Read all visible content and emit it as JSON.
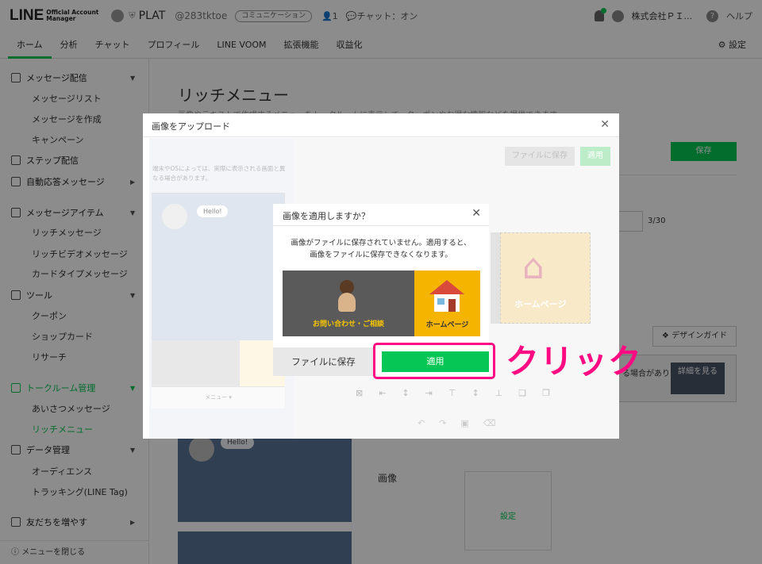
{
  "header": {
    "logo_line": "LINE",
    "logo_sub_1": "Official Account",
    "logo_sub_2": "Manager",
    "account_name": "PLAT",
    "account_id": "@283tktoe",
    "account_tag": "コミュニケーション",
    "friends_count": "1",
    "chat_status": "チャット：オン",
    "company": "株式会社ＰＩ...",
    "help": "ヘルプ"
  },
  "tabs": [
    "ホーム",
    "分析",
    "チャット",
    "プロフィール",
    "LINE VOOM",
    "拡張機能",
    "収益化"
  ],
  "settings_label": "設定",
  "sidebar": {
    "groups": [
      {
        "label": "メッセージ配信",
        "items": [
          "メッセージリスト",
          "メッセージを作成",
          "キャンペーン"
        ]
      },
      {
        "label": "ステップ配信",
        "items": []
      },
      {
        "label": "自動応答メッセージ",
        "items": []
      },
      {
        "label": "メッセージアイテム",
        "items": [
          "リッチメッセージ",
          "リッチビデオメッセージ",
          "カードタイプメッセージ"
        ]
      },
      {
        "label": "ツール",
        "items": [
          "クーポン",
          "ショップカード",
          "リサーチ"
        ]
      },
      {
        "label": "トークルーム管理",
        "items": [
          "あいさつメッセージ",
          "リッチメニュー"
        ]
      },
      {
        "label": "データ管理",
        "items": [
          "オーディエンス",
          "トラッキング(LINE Tag)"
        ]
      },
      {
        "label": "友だちを増やす",
        "items": []
      }
    ],
    "close_menu": "メニューを閉じる"
  },
  "main": {
    "title": "リッチメニュー",
    "subtitle": "画像やテキストで作成するメニューをトークルームに表示して、クーポンやお得な情報などを提供できます。",
    "save_button": "保存",
    "counter": "3/30",
    "design_guide": "デザインガイド",
    "banner_text": "る場合があります",
    "detail_button": "詳細を見る",
    "hello": "Hello!",
    "image_label": "画像",
    "image_setting": "設定"
  },
  "upload_modal": {
    "title": "画像をアップロード",
    "note": "端末やOSによっては、実際に表示される画面と異なる場合があります。",
    "hello": "Hello!",
    "menu_caption": "メニュー ▾",
    "save_file": "ファイルに保存",
    "apply": "適用",
    "canvas_label": "ホームページ"
  },
  "confirm_dialog": {
    "title": "画像を適用しますか？",
    "message_line1": "画像がファイルに保存されていません。適用すると、",
    "message_line2": "画像をファイルに保存できなくなります。",
    "image_left_label": "お問い合わせ・ご相談",
    "image_right_label": "ホームページ",
    "save_file": "ファイルに保存",
    "apply": "適用"
  },
  "annotation": {
    "text": "クリック",
    "color": "#ff0a82"
  },
  "colors": {
    "accent": "#06c755",
    "banner_yellow": "#f5b400"
  }
}
